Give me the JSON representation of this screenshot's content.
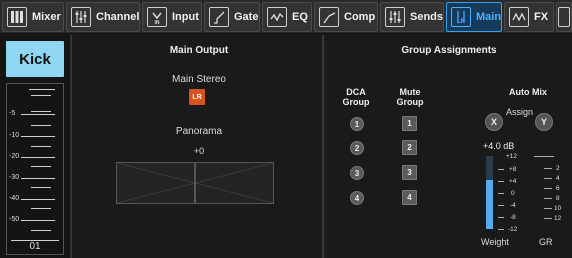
{
  "tabs": [
    {
      "id": "mixer",
      "label": "Mixer",
      "icon": "mixer-grid-icon",
      "active": false
    },
    {
      "id": "channel",
      "label": "Channel",
      "icon": "channel-faders-icon",
      "active": false
    },
    {
      "id": "input",
      "label": "Input",
      "icon": "input-icon",
      "active": false
    },
    {
      "id": "gate",
      "label": "Gate",
      "icon": "gate-curve-icon",
      "active": false
    },
    {
      "id": "eq",
      "label": "EQ",
      "icon": "eq-curve-icon",
      "active": false
    },
    {
      "id": "comp",
      "label": "Comp",
      "icon": "comp-curve-icon",
      "active": false
    },
    {
      "id": "sends",
      "label": "Sends",
      "icon": "sends-faders-icon",
      "active": false
    },
    {
      "id": "main",
      "label": "Main",
      "icon": "main-lr-icon",
      "active": true
    },
    {
      "id": "fx",
      "label": "FX",
      "icon": "fx-wave-icon",
      "active": false
    }
  ],
  "channel_strip": {
    "name": "Kick",
    "name_bg": "#8fd6f2",
    "meter_scale": [
      "-5",
      "-10",
      "-20",
      "-30",
      "-40",
      "-50"
    ],
    "channel_number": "01"
  },
  "main_output": {
    "title": "Main Output",
    "stereo_label": "Main Stereo",
    "lr_button": "LR",
    "lr_color": "#d9531e",
    "panorama_label": "Panorama",
    "panorama_value": "+0"
  },
  "group_assignments": {
    "title": "Group Assignments",
    "dca_header": [
      "DCA",
      "Group"
    ],
    "mute_header": [
      "Mute",
      "Group"
    ],
    "dca_buttons": [
      "1",
      "2",
      "3",
      "4"
    ],
    "mute_buttons": [
      "1",
      "2",
      "3",
      "4"
    ],
    "auto_mix": {
      "title": "Auto Mix",
      "assign_label": "Assign",
      "x_label": "X",
      "y_label": "Y",
      "gain_readout": "+4.0 dB",
      "weight_scale": [
        "+12",
        "+8",
        "+4",
        "0",
        "-4",
        "-8",
        "-12"
      ],
      "weight_level_db": 4.0,
      "weight_color": "#58a8ec",
      "gr_scale": [
        "2",
        "4",
        "6",
        "8",
        "10",
        "12"
      ],
      "weight_label": "Weight",
      "gr_label": "GR"
    }
  }
}
